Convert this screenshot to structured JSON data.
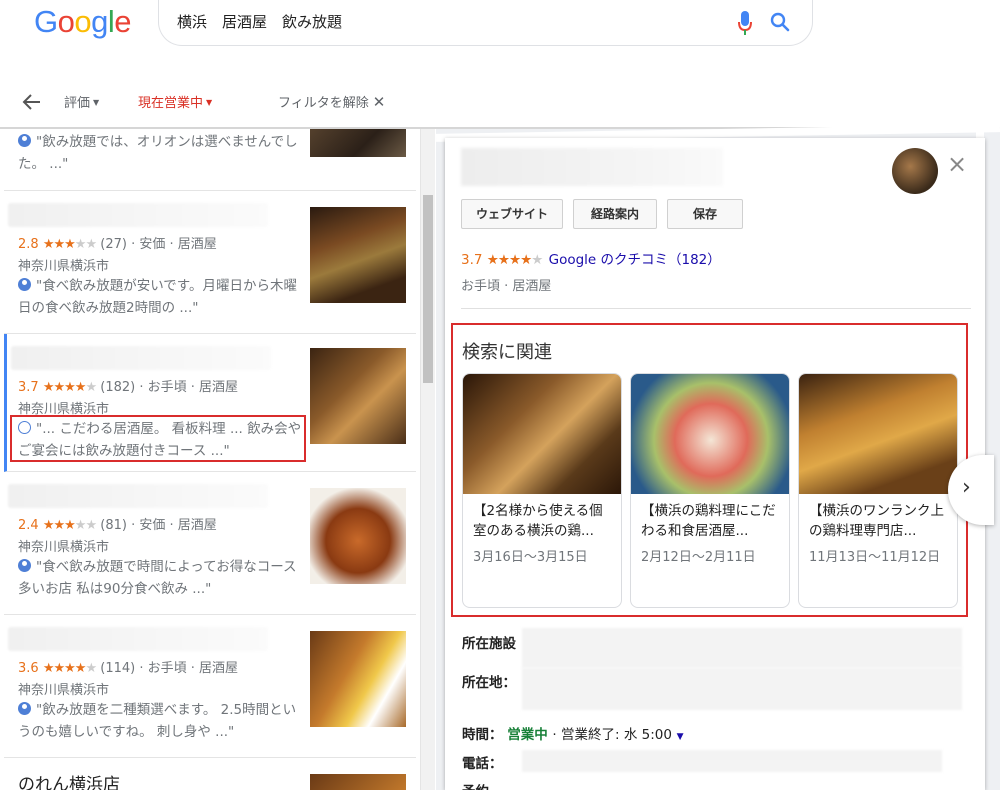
{
  "search": {
    "query": "横浜　居酒屋　飲み放題"
  },
  "filters": {
    "rating": "評価",
    "open_now": "現在営業中",
    "clear": "フィルタを解除",
    "clear_x": "✕"
  },
  "colors": {
    "accent_red": "#d93025",
    "star": "#e7711b",
    "link": "#1a0dab",
    "open": "#188038"
  },
  "results": [
    {
      "review_text": "\"飲み放題では、オリオンは選べませんでした。 ...\"",
      "review_bold": "飲み放題"
    },
    {
      "score": "2.8",
      "stars": 3,
      "count": "(27)",
      "meta": "· 安価 · 居酒屋",
      "address": "神奈川県横浜市",
      "review_text": "\"食べ飲み放題が安いです。月曜日から木曜日の食べ飲み放題2時間の ...\""
    },
    {
      "score": "3.7",
      "stars": 3.5,
      "count": "(182)",
      "meta": "· お手頃 · 居酒屋",
      "address": "神奈川県横浜市",
      "review_text": "\"... こだわる居酒屋。 看板料理 ... 飲み会やご宴会には飲み放題付きコース ...\""
    },
    {
      "score": "2.4",
      "stars": 2.5,
      "count": "(81)",
      "meta": "· 安価 · 居酒屋",
      "address": "神奈川県横浜市",
      "review_text": "\"食べ飲み放題で時間によってお得なコース多いお店 私は90分食べ飲み ...\""
    },
    {
      "score": "3.6",
      "stars": 3.5,
      "count": "(114)",
      "meta": "· お手頃 · 居酒屋",
      "address": "神奈川県横浜市",
      "review_text": "\"飲み放題を二種類選べます。 2.5時間というのも嬉しいですね。 刺し身や ...\""
    },
    {
      "name": "のれん横浜店"
    }
  ],
  "detail": {
    "buttons": {
      "website": "ウェブサイト",
      "directions": "経路案内",
      "save": "保存"
    },
    "score": "3.7",
    "stars": 3.5,
    "reviews_link": "Google のクチコミ（182）",
    "category": "お手頃 · 居酒屋",
    "related_title": "検索に関連",
    "posts": [
      {
        "text": "【2名様から使える個室のある横浜の鶏...",
        "date": "3月16日～3月15日"
      },
      {
        "text": "【横浜の鶏料理にこだわる和食居酒屋...",
        "date": "2月12日～2月11日"
      },
      {
        "text": "【横浜のワンランク上の鶏料理専門店...",
        "date": "11月13日～11月12日"
      }
    ],
    "info": {
      "facility_label": "所在施設",
      "address_label": "所在地：",
      "hours_label": "時間：",
      "hours_open": "営業中",
      "hours_rest": "· 営業終了: 水 5:00",
      "phone_label": "電話：",
      "cut_label": "予約"
    }
  }
}
